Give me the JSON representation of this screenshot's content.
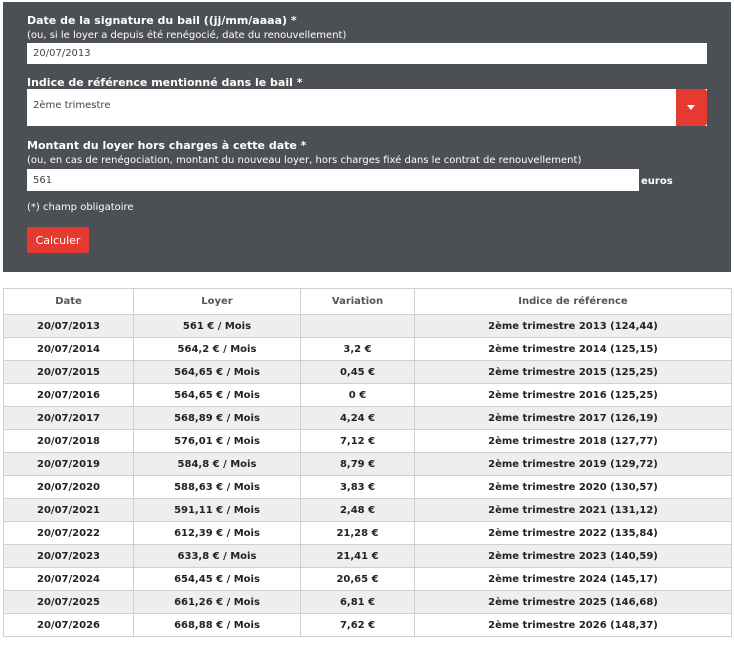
{
  "form": {
    "signature_label": "Date de la signature du bail ((jj/mm/aaaa) *",
    "signature_hint": "(ou, si le loyer a depuis été renégocié, date du renouvellement)",
    "signature_value": "20/07/2013",
    "index_label": "Indice de référence mentionné dans le bail *",
    "index_value": "2ème trimestre",
    "rent_label": "Montant du loyer hors charges à cette date *",
    "rent_hint": "(ou, en cas de renégociation, montant du nouveau loyer, hors charges fixé dans le contrat de renouvellement)",
    "rent_value": "561",
    "rent_unit": "euros",
    "required_note": "(*) champ obligatoire",
    "submit_label": "Calculer"
  },
  "colors": {
    "panel_bg": "#4c4f54",
    "accent": "#e53a2f",
    "row_alt": "#eceeef"
  },
  "icons": {
    "select_arrow": "caret-down-icon"
  },
  "table": {
    "headers": [
      "Date",
      "Loyer",
      "Variation",
      "Indice de référence"
    ],
    "rows": [
      [
        "20/07/2013",
        "561 € / Mois",
        "",
        "2ème trimestre 2013 (124,44)"
      ],
      [
        "20/07/2014",
        "564,2 € / Mois",
        "3,2 €",
        "2ème trimestre 2014 (125,15)"
      ],
      [
        "20/07/2015",
        "564,65 € / Mois",
        "0,45 €",
        "2ème trimestre 2015 (125,25)"
      ],
      [
        "20/07/2016",
        "564,65 € / Mois",
        "0 €",
        "2ème trimestre 2016 (125,25)"
      ],
      [
        "20/07/2017",
        "568,89 € / Mois",
        "4,24 €",
        "2ème trimestre 2017 (126,19)"
      ],
      [
        "20/07/2018",
        "576,01 € / Mois",
        "7,12 €",
        "2ème trimestre 2018 (127,77)"
      ],
      [
        "20/07/2019",
        "584,8 € / Mois",
        "8,79 €",
        "2ème trimestre 2019 (129,72)"
      ],
      [
        "20/07/2020",
        "588,63 € / Mois",
        "3,83 €",
        "2ème trimestre 2020 (130,57)"
      ],
      [
        "20/07/2021",
        "591,11 € / Mois",
        "2,48 €",
        "2ème trimestre 2021 (131,12)"
      ],
      [
        "20/07/2022",
        "612,39 € / Mois",
        "21,28 €",
        "2ème trimestre 2022 (135,84)"
      ],
      [
        "20/07/2023",
        "633,8 € / Mois",
        "21,41 €",
        "2ème trimestre 2023 (140,59)"
      ],
      [
        "20/07/2024",
        "654,45 € / Mois",
        "20,65 €",
        "2ème trimestre 2024 (145,17)"
      ],
      [
        "20/07/2025",
        "661,26 € / Mois",
        "6,81 €",
        "2ème trimestre 2025 (146,68)"
      ],
      [
        "20/07/2026",
        "668,88 € / Mois",
        "7,62 €",
        "2ème trimestre 2026 (148,37)"
      ]
    ]
  }
}
